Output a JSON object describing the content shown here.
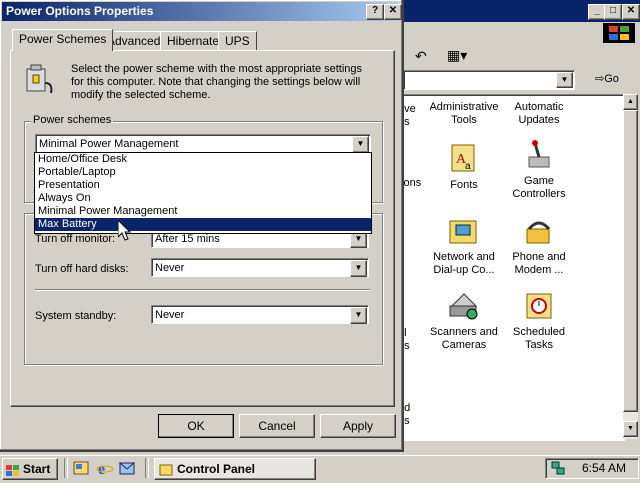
{
  "dialog": {
    "title": "Power Options Properties",
    "help_btn": "?",
    "close_btn": "✕",
    "tabs": [
      "Power Schemes",
      "Advanced",
      "Hibernate",
      "UPS"
    ],
    "description": "Select the power scheme with the most appropriate settings for this computer. Note that changing the settings below will modify the selected scheme.",
    "power_schemes_label": "Power schemes",
    "selected_scheme": "Minimal Power Management",
    "dropdown_options": [
      "Home/Office Desk",
      "Portable/Laptop",
      "Presentation",
      "Always On",
      "Minimal Power Management",
      "Max Battery"
    ],
    "highlighted_option": "Max Battery",
    "settings": {
      "turn_off_monitor_label": "Turn off monitor:",
      "turn_off_monitor_value": "After 15 mins",
      "turn_off_disks_label": "Turn off hard disks:",
      "turn_off_disks_value": "Never",
      "system_standby_label": "System standby:",
      "system_standby_value": "Never"
    },
    "buttons": {
      "ok": "OK",
      "cancel": "Cancel",
      "apply": "Apply"
    }
  },
  "control_panel": {
    "title_buttons": [
      "_",
      "□",
      "✕"
    ],
    "go_label": "Go",
    "partial_left": [
      "ove",
      "ns",
      "tions",
      "al",
      "ns",
      "nd",
      "ds"
    ],
    "items": [
      {
        "label": "Administrative Tools",
        "icon": "administrative-tools-icon"
      },
      {
        "label": "Automatic Updates",
        "icon": "automatic-updates-icon"
      },
      {
        "label": "Fonts",
        "icon": "fonts-icon"
      },
      {
        "label": "Game Controllers",
        "icon": "game-controllers-icon"
      },
      {
        "label": "Network and Dial-up Co...",
        "icon": "network-icon"
      },
      {
        "label": "Phone and Modem ...",
        "icon": "phone-modem-icon"
      },
      {
        "label": "Scanners and Cameras",
        "icon": "scanner-icon"
      },
      {
        "label": "Scheduled Tasks",
        "icon": "scheduled-tasks-icon"
      }
    ]
  },
  "taskbar": {
    "start_label": "Start",
    "task_label": "Control Panel",
    "clock": "6:54 AM"
  }
}
